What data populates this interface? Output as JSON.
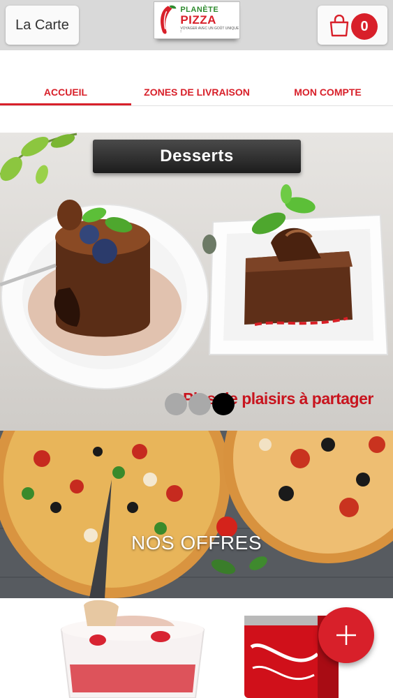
{
  "header": {
    "menu_label": "La Carte",
    "logo": {
      "line1": "PLANÈTE",
      "line2": "PIZZA",
      "tagline": "VOYAGER AVEC UN GOÛT UNIQUE !"
    },
    "cart": {
      "count": "0",
      "icon": "shopping-bag-icon"
    }
  },
  "tabs": [
    {
      "label": "ACCUEIL",
      "active": true
    },
    {
      "label": "ZONES DE LIVRAISON",
      "active": false
    },
    {
      "label": "MON COMPTE",
      "active": false
    }
  ],
  "banner": {
    "title": "Desserts",
    "tagline": "Plus de plaisirs à partager",
    "slides": 3,
    "active_slide": 3
  },
  "offers": {
    "label": "NOS OFFRES"
  },
  "fab": {
    "icon": "plus-icon"
  },
  "colors": {
    "brand_red": "#d8202a",
    "topbar": "#d9d9d9",
    "brand_green": "#2e8b2e"
  }
}
